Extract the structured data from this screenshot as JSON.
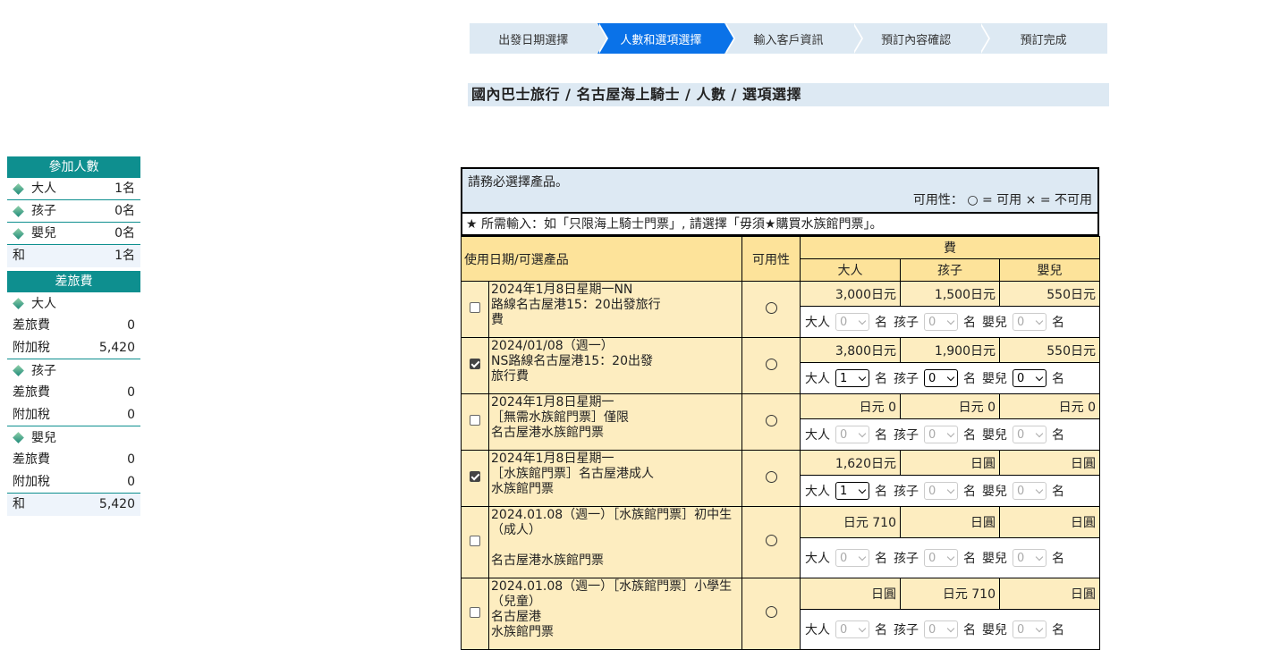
{
  "steps": [
    "出發日期選擇",
    "人數和選項選擇",
    "輸入客戶資訊",
    "預訂內容確認",
    "預訂完成"
  ],
  "breadcrumb": "國內巴士旅行 / 名古屋海上騎士 / 人數 / 選項選擇",
  "sidebar": {
    "participants_title": "參加人數",
    "participants": [
      {
        "label": "大人",
        "value": "1名"
      },
      {
        "label": "孩子",
        "value": "0名"
      },
      {
        "label": "嬰兒",
        "value": "0名"
      }
    ],
    "participants_total": {
      "label": "和",
      "value": "1名"
    },
    "fee_title": "差旅費",
    "groups": [
      {
        "name": "大人",
        "rows": [
          {
            "label": "差旅費",
            "value": "0"
          },
          {
            "label": "附加稅",
            "value": "5,420"
          }
        ]
      },
      {
        "name": "孩子",
        "rows": [
          {
            "label": "差旅費",
            "value": "0"
          },
          {
            "label": "附加稅",
            "value": "0"
          }
        ]
      },
      {
        "name": "嬰兒",
        "rows": [
          {
            "label": "差旅費",
            "value": "0"
          },
          {
            "label": "附加稅",
            "value": "0"
          }
        ]
      }
    ],
    "fee_total": {
      "label": "和",
      "value": "5,420"
    }
  },
  "notice": {
    "select_required": "請務必選擇產品。",
    "availability_legend": "可用性： ○ = 可用 × = 不可用",
    "required_input": "★ 所需輸入：如「只限海上騎士門票」, 請選擇「毋須★購買水族館門票」。"
  },
  "table": {
    "col_product": "使用日期/可選產品",
    "col_avail": "可用性",
    "col_fee": "費",
    "col_adult": "大人",
    "col_child": "孩子",
    "col_infant": "嬰兒",
    "qty_adult": "大人",
    "qty_child": "孩子",
    "qty_infant": "嬰兒",
    "qty_unit": "名",
    "rows": [
      {
        "lines": [
          "2024年1月8日星期一NN",
          "路線名古屋港15：20出發旅行",
          "費"
        ],
        "checked": false,
        "avail": "○",
        "prices": [
          "3,000日元",
          "1,500日元",
          "550日元"
        ],
        "qty": [
          "0",
          "0",
          "0"
        ],
        "enabled": [
          false,
          false,
          false
        ]
      },
      {
        "lines": [
          "2024/01/08（週一）",
          "NS路線名古屋港15：20出發",
          "旅行費"
        ],
        "checked": true,
        "avail": "○",
        "prices": [
          "3,800日元",
          "1,900日元",
          "550日元"
        ],
        "qty": [
          "1",
          "0",
          "0"
        ],
        "enabled": [
          true,
          true,
          true
        ]
      },
      {
        "lines": [
          "2024年1月8日星期一",
          "［無需水族館門票］僅限",
          "名古屋港水族館門票"
        ],
        "checked": false,
        "avail": "○",
        "prices": [
          "日元 0",
          "日元 0",
          "日元 0"
        ],
        "qty": [
          "0",
          "0",
          "0"
        ],
        "enabled": [
          false,
          false,
          false
        ]
      },
      {
        "lines": [
          "2024年1月8日星期一",
          "［水族館門票］名古屋港成人",
          "水族館門票"
        ],
        "checked": true,
        "avail": "○",
        "prices": [
          "1,620日元",
          "日圓",
          "日圓"
        ],
        "qty": [
          "1",
          "0",
          "0"
        ],
        "enabled": [
          true,
          false,
          false
        ]
      },
      {
        "lines": [
          "2024.01.08（週一）［水族館門票］初中生",
          "（成人）",
          "",
          "名古屋港水族館門票"
        ],
        "checked": false,
        "avail": "○",
        "prices": [
          "日元 710",
          "日圓",
          "日圓"
        ],
        "qty": [
          "0",
          "0",
          "0"
        ],
        "enabled": [
          false,
          false,
          false
        ]
      },
      {
        "lines": [
          "2024.01.08（週一）［水族館門票］小學生",
          "（兒童）",
          "名古屋港",
          "水族館門票"
        ],
        "checked": false,
        "avail": "○",
        "prices": [
          "日圓",
          "日元 710",
          "日圓"
        ],
        "qty": [
          "0",
          "0",
          "0"
        ],
        "enabled": [
          false,
          false,
          false
        ]
      }
    ]
  }
}
